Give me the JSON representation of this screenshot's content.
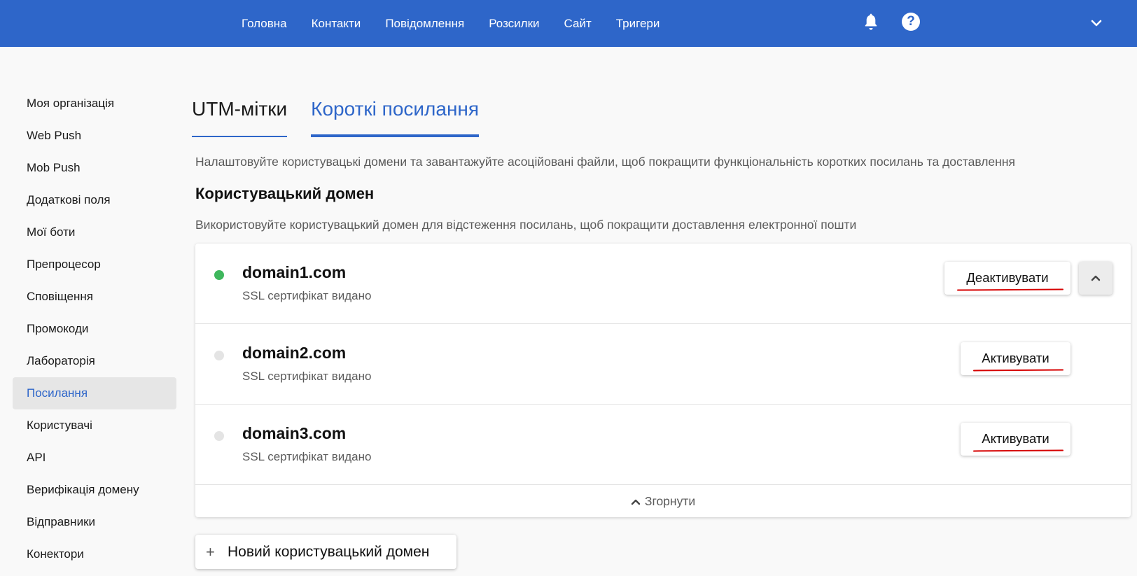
{
  "nav": {
    "items": [
      "Головна",
      "Контакти",
      "Повідомлення",
      "Розсилки",
      "Сайт",
      "Тригери"
    ],
    "bell_icon": "bell-icon",
    "help_icon": "help-icon",
    "help_glyph": "?",
    "menu_icon": "chevron-down-icon"
  },
  "sidebar": {
    "items": [
      {
        "label": "Моя організація"
      },
      {
        "label": "Web Push"
      },
      {
        "label": "Mob Push"
      },
      {
        "label": "Додаткові поля"
      },
      {
        "label": "Мої боти"
      },
      {
        "label": "Препроцесор"
      },
      {
        "label": "Сповіщення"
      },
      {
        "label": "Промокоди"
      },
      {
        "label": "Лабораторія"
      },
      {
        "label": "Посилання",
        "active": true
      },
      {
        "label": "Користувачі"
      },
      {
        "label": "API"
      },
      {
        "label": "Верифікація домену"
      },
      {
        "label": "Відправники"
      },
      {
        "label": "Конектори"
      }
    ]
  },
  "tabs": [
    "UTM-мітки",
    "Короткі посилання"
  ],
  "active_tab": "Короткі посилання",
  "main": {
    "description": "Налаштовуйте користувацькі домени та завантажуйте асоційовані файли, щоб покращити функціональність коротких посилань та доставлення",
    "section_title": "Користувацький домен",
    "section_description": "Використовуйте користувацький домен для відстеження посилань, щоб покращити доставлення електронної пошти"
  },
  "domains": [
    {
      "name": "domain1.com",
      "status": "SSL сертифікат видано",
      "active": true,
      "action": "Деактивувати"
    },
    {
      "name": "domain2.com",
      "status": "SSL сертифікат видано",
      "active": false,
      "action": "Активувати"
    },
    {
      "name": "domain3.com",
      "status": "SSL сертифікат видано",
      "active": false,
      "action": "Активувати"
    }
  ],
  "collapse_label": "Згорнути",
  "new_domain_plus": "+",
  "new_domain_label": "Новий користувацький домен",
  "colors": {
    "header": "#2e66c9",
    "accent": "#2e66c9",
    "active_dot": "#3fb75d",
    "inactive_dot": "#e4e4e4",
    "annotation_underline": "#d60000"
  }
}
